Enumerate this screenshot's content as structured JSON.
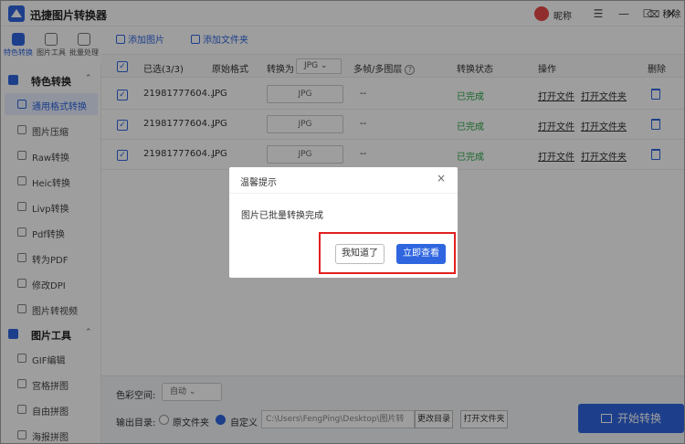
{
  "app": {
    "title": "迅捷图片转换器",
    "nickname": "昵称"
  },
  "window": {
    "menu": "☰",
    "minimize": "—",
    "maximize": "☐",
    "close": "✕"
  },
  "top_tabs": [
    {
      "label": "特色转换",
      "active": true
    },
    {
      "label": "图片工具",
      "active": false
    },
    {
      "label": "批量处理",
      "active": false
    }
  ],
  "sidebar": {
    "group1": {
      "label": "特色转换",
      "arrow": "⌃"
    },
    "items1": [
      {
        "label": "通用格式转换",
        "active": true
      },
      {
        "label": "图片压缩"
      },
      {
        "label": "Raw转换"
      },
      {
        "label": "Heic转换"
      },
      {
        "label": "Livp转换"
      },
      {
        "label": "Pdf转换"
      },
      {
        "label": "转为PDF"
      },
      {
        "label": "修改DPI"
      },
      {
        "label": "图片转视频"
      }
    ],
    "group2": {
      "label": "图片工具",
      "arrow": "⌃"
    },
    "items2": [
      {
        "label": "GIF编辑"
      },
      {
        "label": "宫格拼图"
      },
      {
        "label": "自由拼图"
      },
      {
        "label": "海报拼图"
      }
    ]
  },
  "toolbar": {
    "add_image": "添加图片",
    "add_folder": "添加文件夹",
    "remove": "移除"
  },
  "table": {
    "headers": {
      "selected": "已选(3/3)",
      "format": "原始格式",
      "convert_to": "转换为",
      "convert_to_value": "JPG",
      "multiframe": "多帧/多图层",
      "status": "转换状态",
      "action": "操作",
      "delete": "删除"
    },
    "rows": [
      {
        "name": "21981777604...",
        "format": "JPG",
        "target": "JPG",
        "frames": "--",
        "status": "已完成",
        "open_file": "打开文件",
        "open_folder": "打开文件夹"
      },
      {
        "name": "21981777604...",
        "format": "JPG",
        "target": "JPG",
        "frames": "--",
        "status": "已完成",
        "open_file": "打开文件",
        "open_folder": "打开文件夹"
      },
      {
        "name": "21981777604...",
        "format": "JPG",
        "target": "JPG",
        "frames": "--",
        "status": "已完成",
        "open_file": "打开文件",
        "open_folder": "打开文件夹"
      }
    ]
  },
  "bottom": {
    "color_space_label": "色彩空间:",
    "color_space_value": "自动",
    "output_label": "输出目录:",
    "opt_original": "原文件夹",
    "opt_custom": "自定义",
    "path": "C:\\Users\\FengPing\\Desktop\\图片转",
    "change_dir": "更改目录",
    "open_folder": "打开文件夹",
    "start": "开始转换"
  },
  "dialog": {
    "title": "温馨提示",
    "close": "×",
    "message": "图片已批量转换完成",
    "btn_know": "我知道了",
    "btn_view": "立即查看"
  },
  "colors": {
    "accent": "#2f66e0",
    "success": "#2aa547",
    "highlight": "#e02020"
  }
}
